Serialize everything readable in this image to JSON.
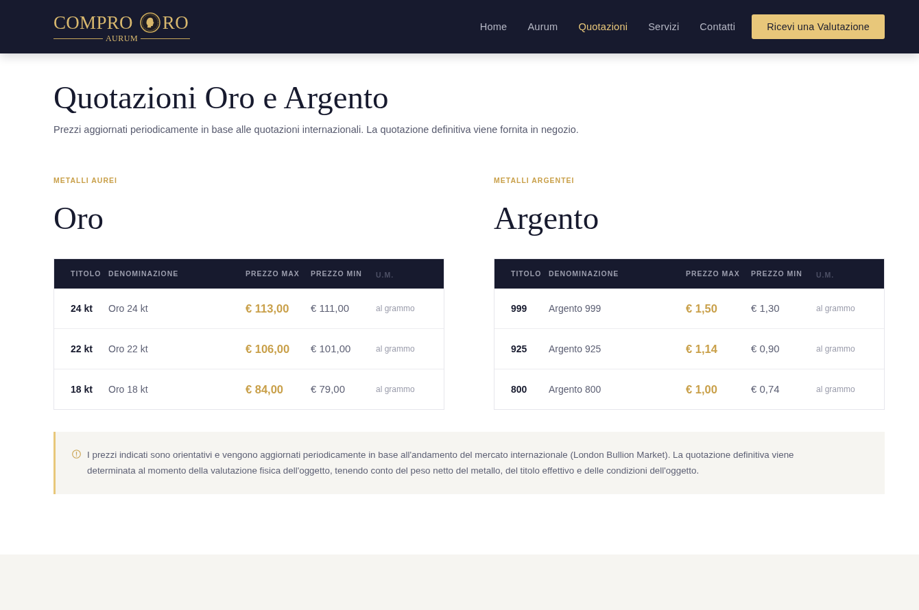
{
  "header": {
    "logo": {
      "text_left": "COMPRO",
      "text_right": "RO",
      "tagline": "AURUM"
    },
    "nav": [
      {
        "label": "Home",
        "selected": false
      },
      {
        "label": "Aurum",
        "selected": false
      },
      {
        "label": "Quotazioni",
        "selected": true
      },
      {
        "label": "Servizi",
        "selected": false
      },
      {
        "label": "Contatti",
        "selected": false
      }
    ],
    "cta": "Ricevi una Valutazione"
  },
  "intro": {
    "title": "Quotazioni Oro e Argento",
    "subtitle": "Prezzi aggiornati periodicamente in base alle quotazioni internazionali. La quotazione definitiva viene fornita in negozio."
  },
  "sections": [
    {
      "eyebrow": "METALLI AUREI",
      "title": "Oro",
      "table": {
        "columns": [
          "TITOLO",
          "DENOMINAZIONE",
          "PREZZO MAX",
          "PREZZO MIN",
          "U.M."
        ],
        "rows": [
          [
            "24 kt",
            "Oro 24 kt",
            "€ 113,00",
            "€ 111,00",
            "al grammo"
          ],
          [
            "22 kt",
            "Oro 22 kt",
            "€ 106,00",
            "€ 101,00",
            "al grammo"
          ],
          [
            "18 kt",
            "Oro 18 kt",
            "€ 84,00",
            "€ 79,00",
            "al grammo"
          ]
        ]
      }
    },
    {
      "eyebrow": "METALLI ARGENTEI",
      "title": "Argento",
      "table": {
        "columns": [
          "TITOLO",
          "DENOMINAZIONE",
          "PREZZO MAX",
          "PREZZO MIN",
          "U.M."
        ],
        "rows": [
          [
            "999",
            "Argento 999",
            "€ 1,50",
            "€ 1,30",
            "al grammo"
          ],
          [
            "925",
            "Argento 925",
            "€ 1,14",
            "€ 0,90",
            "al grammo"
          ],
          [
            "800",
            "Argento 800",
            "€ 1,00",
            "€ 0,74",
            "al grammo"
          ]
        ]
      }
    }
  ],
  "notice": {
    "text": "I prezzi indicati sono orientativi e vengono aggiornati periodicamente in base all'andamento del mercato internazionale (London Bullion Market). La quotazione definitiva viene determinata al momento della valutazione fisica dell'oggetto, tenendo conto del peso netto del metallo, del titolo effettivo e delle condizioni dell'oggetto."
  }
}
